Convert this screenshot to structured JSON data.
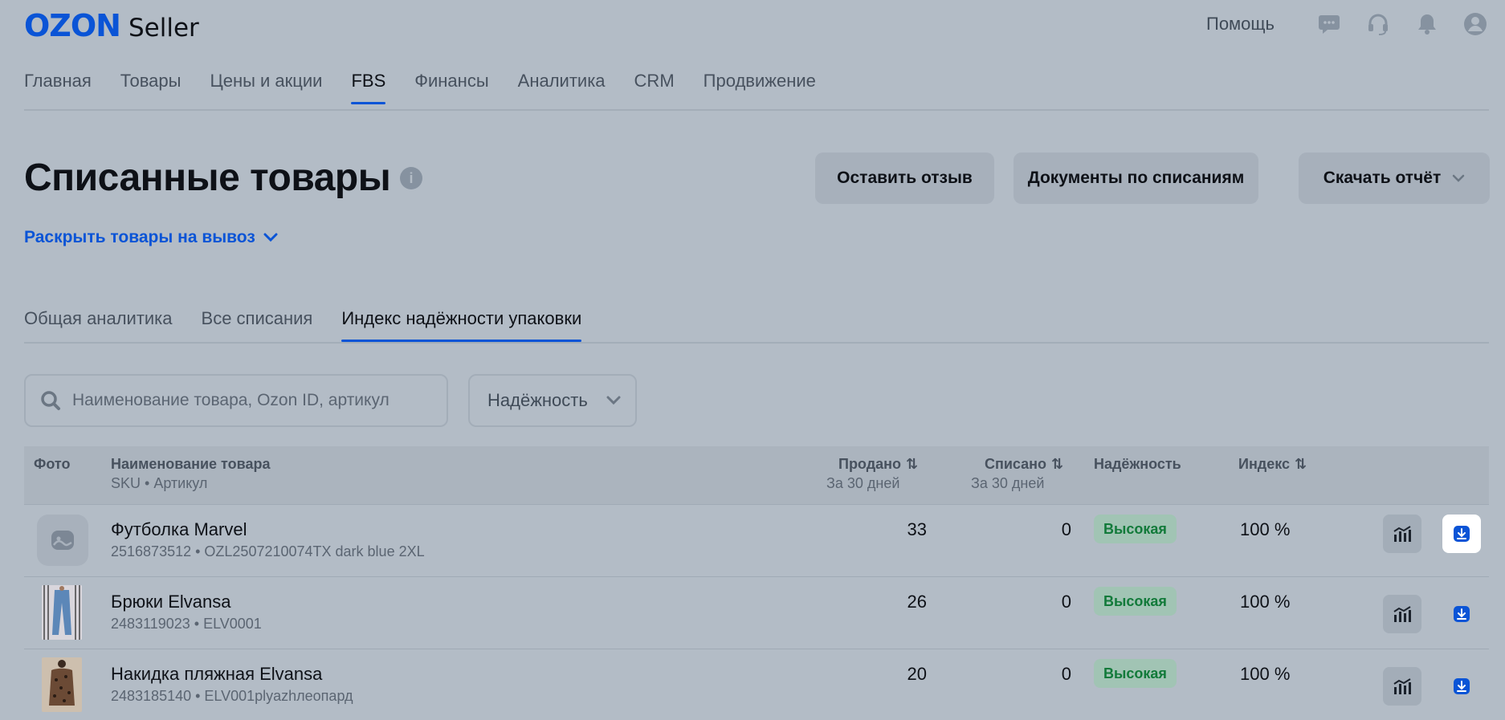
{
  "header": {
    "logo_brand": "OZON",
    "logo_product": "Seller",
    "help_label": "Помощь",
    "icons": [
      "chat-icon",
      "headset-icon",
      "bell-icon",
      "profile-icon"
    ]
  },
  "nav": {
    "items": [
      {
        "label": "Главная",
        "active": false
      },
      {
        "label": "Товары",
        "active": false
      },
      {
        "label": "Цены и акции",
        "active": false
      },
      {
        "label": "FBS",
        "active": true
      },
      {
        "label": "Финансы",
        "active": false
      },
      {
        "label": "Аналитика",
        "active": false
      },
      {
        "label": "CRM",
        "active": false
      },
      {
        "label": "Продвижение",
        "active": false
      }
    ]
  },
  "page": {
    "title": "Списанные товары",
    "info_glyph": "i",
    "buttons": {
      "feedback": "Оставить отзыв",
      "documents": "Документы по списаниям",
      "download": "Скачать отчёт"
    },
    "expand_link": "Раскрыть товары на вывоз"
  },
  "tabs": [
    {
      "label": "Общая аналитика",
      "active": false
    },
    {
      "label": "Все списания",
      "active": false
    },
    {
      "label": "Индекс надёжности упаковки",
      "active": true
    }
  ],
  "filters": {
    "search_placeholder": "Наименование товара, Ozon ID, артикул",
    "reliability_select": "Надёжность"
  },
  "table": {
    "headers": {
      "photo": "Фото",
      "name": "Наименование товара",
      "name_sub": "SKU • Артикул",
      "sold": "Продано",
      "sold_sub": "За 30 дней",
      "written_off": "Списано",
      "written_off_sub": "За 30 дней",
      "reliability": "Надёжность",
      "index": "Индекс",
      "sort_glyph": "⇅"
    },
    "rows": [
      {
        "name": "Футболка Marvel",
        "sku": "2516873512 • OZL2507210074TX dark blue 2XL",
        "sold": "33",
        "written_off": "0",
        "reliability": "Высокая",
        "index": "100 %",
        "photo": "placeholder"
      },
      {
        "name": "Брюки Elvansa",
        "sku": "2483119023 • ELV0001",
        "sold": "26",
        "written_off": "0",
        "reliability": "Высокая",
        "index": "100 %",
        "photo": "pants"
      },
      {
        "name": "Накидка пляжная Elvansa",
        "sku": "2483185140 • ELV001plyazhлеопард",
        "sold": "20",
        "written_off": "0",
        "reliability": "Высокая",
        "index": "100 %",
        "photo": "beach-cover"
      }
    ]
  },
  "colors": {
    "accent": "#0a54d6",
    "badge_bg": "#a1c4b4",
    "badge_text": "#127a3a"
  }
}
